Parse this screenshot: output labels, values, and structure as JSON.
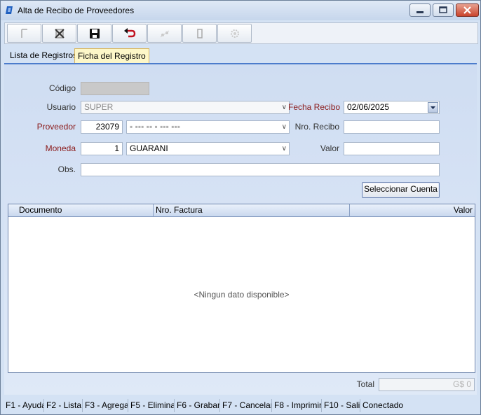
{
  "window": {
    "title": "Alta de Recibo de Proveedores",
    "icon": "app-logo-icon",
    "controls": [
      "minimize-icon",
      "maximize-icon",
      "close-icon"
    ]
  },
  "toolbar": {
    "buttons": [
      {
        "icon": "new-icon",
        "enabled": false
      },
      {
        "icon": "delete-icon",
        "enabled": true
      },
      {
        "icon": "save-icon",
        "enabled": true
      },
      {
        "icon": "undo-icon",
        "enabled": true
      },
      {
        "icon": "search-icon",
        "enabled": false
      },
      {
        "icon": "print-icon",
        "enabled": false
      },
      {
        "icon": "settings-icon",
        "enabled": false
      }
    ]
  },
  "tabs": [
    {
      "label": "Lista de Registros",
      "active": false
    },
    {
      "label": "Ficha del Registro",
      "active": true
    }
  ],
  "form": {
    "codigo": {
      "label": "Código",
      "value": ""
    },
    "usuario": {
      "label": "Usuario",
      "value": "SUPER"
    },
    "fecha_recibo": {
      "label": "Fecha Recibo",
      "value": "02/06/2025"
    },
    "proveedor": {
      "label": "Proveedor",
      "code": "23079",
      "name": "▪ ▪▪▪ ▪▪ ▪ ▪▪▪ ▪▪▪"
    },
    "nro_recibo": {
      "label": "Nro. Recibo",
      "value": ""
    },
    "moneda": {
      "label": "Moneda",
      "code": "1",
      "name": "GUARANI"
    },
    "valor": {
      "label": "Valor",
      "value": ""
    },
    "obs": {
      "label": "Obs.",
      "value": ""
    },
    "select_account_button": "Seleccionar Cuenta"
  },
  "grid": {
    "columns": [
      "Documento",
      "Nro. Factura",
      "Valor"
    ],
    "rows": [],
    "empty_text": "<Ningun dato disponible>"
  },
  "total": {
    "label": "Total",
    "value": "G$ 0"
  },
  "status_bar": [
    "F1 - Ayuda",
    "F2 - Lista",
    "F3 - Agregar",
    "F5 - Eliminar",
    "F6 - Grabar",
    "F7 - Cancelar",
    "F8 - Imprimir",
    "F10 - Salir",
    "Conectado"
  ],
  "colors": {
    "accent": "#4c7ccc",
    "required_label": "#8b1a1a",
    "active_tab": "#fdf7c8"
  }
}
